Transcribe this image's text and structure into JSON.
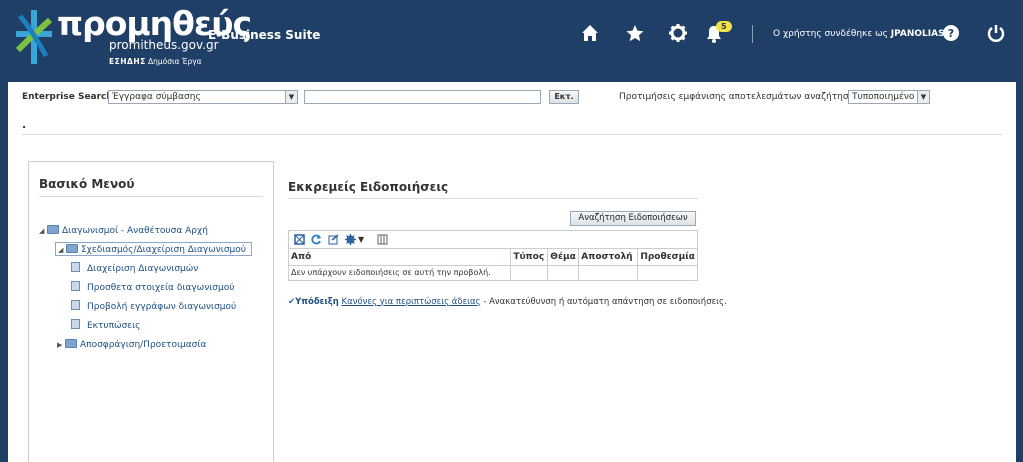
{
  "header": {
    "logo_word": "προμηθεύς",
    "logo_site": "promitheus.gov.gr",
    "logo_essh": "ΕΣΗΔΗΣ",
    "logo_dimosia": "Δημόσια Έργα",
    "app_title": "E-Business Suite",
    "notification_count": "5",
    "user_prefix": "Ο χρήστης συνδέθηκε ως ",
    "user_name": "JPANOLIAS",
    "icons": [
      "home-icon",
      "favorites-star-icon",
      "settings-gear-icon",
      "notifications-bell-icon",
      "help-icon",
      "logout-power-icon"
    ],
    "colors": {
      "background": "#1f3f66",
      "badge": "#f0e24a"
    }
  },
  "search": {
    "label": "Enterprise Search",
    "type_value": "Έγγραφα σύμβασης",
    "query_value": "",
    "go_label": "Εκτ.",
    "pref_label": "Προτιμήσεις εμφάνισης αποτελεσμάτων αναζήτησης",
    "pref_value": "Τυποποιημένο"
  },
  "dot": ".",
  "menu": {
    "title": "Βασικό Μενού",
    "root": "Διαγωνισμοί - Αναθέτουσα Αρχή",
    "selected": "Σχεδιασμός/Διαχείριση Διαγωνισμού",
    "children": [
      "Διαχείριση Διαγωνισμών",
      "Προσθετα στοιχεία διαγωνισμού",
      "Προβολή εγγράφων διαγωνισμού",
      "Εκτυπώσεις"
    ],
    "collapsed": "Αποσφράγιση/Προετοιμασία"
  },
  "notifications": {
    "title": "Εκκρεμείς Ειδοποιήσεις",
    "search_button": "Αναζήτηση Ειδοποιήσεων",
    "columns": [
      "Από",
      "Τύπος",
      "Θέμα",
      "Αποστολή",
      "Προθεσμία"
    ],
    "empty_row": "Δεν υπάρχουν ειδοποιήσεις σε αυτή την προβολή.",
    "toolbar_icons": [
      "detach-icon",
      "refresh-icon",
      "export-icon",
      "actions-gear-icon",
      "chevron-down-icon",
      "columns-icon"
    ],
    "tip_label": "Υπόδειξη",
    "tip_link": "Κανόνες για περιπτώσεις άδειας",
    "tip_text": " - Ανακατεύθυνση ή αυτόματη απάντηση σε ειδοποιήσεις."
  }
}
